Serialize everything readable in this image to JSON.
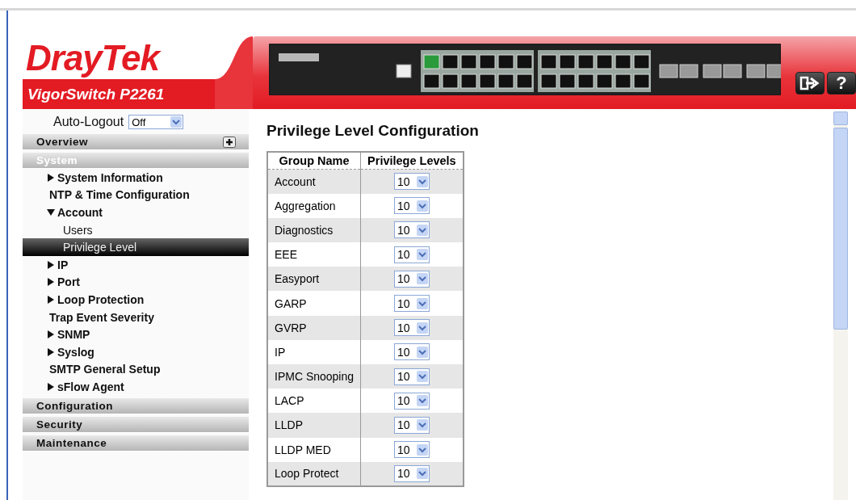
{
  "header": {
    "logo": "DrayTek",
    "model": "VigorSwitch P2261",
    "help_button": "?"
  },
  "auto_logout": {
    "label": "Auto-Logout",
    "value": "Off"
  },
  "sidebar": {
    "sections": [
      {
        "label": "Overview",
        "selected": false
      },
      {
        "label": "System",
        "selected": true,
        "children": [
          {
            "label": "System Information",
            "kind": "folder",
            "expanded": false,
            "selected": false
          },
          {
            "label": "NTP & Time Configuration",
            "kind": "leaf",
            "selected": false
          },
          {
            "label": "Account",
            "kind": "folder",
            "expanded": true,
            "selected": false,
            "children": [
              {
                "label": "Users",
                "kind": "leaf",
                "selected": false
              },
              {
                "label": "Privilege Level",
                "kind": "leaf",
                "selected": true
              }
            ]
          },
          {
            "label": "IP",
            "kind": "folder",
            "expanded": false,
            "selected": false
          },
          {
            "label": "Port",
            "kind": "folder",
            "expanded": false,
            "selected": false
          },
          {
            "label": "Loop Protection",
            "kind": "folder",
            "expanded": false,
            "selected": false
          },
          {
            "label": "Trap Event Severity",
            "kind": "leaf",
            "selected": false
          },
          {
            "label": "SNMP",
            "kind": "folder",
            "expanded": false,
            "selected": false
          },
          {
            "label": "Syslog",
            "kind": "folder",
            "expanded": false,
            "selected": false
          },
          {
            "label": "SMTP General Setup",
            "kind": "leaf",
            "selected": false
          },
          {
            "label": "sFlow Agent",
            "kind": "folder",
            "expanded": false,
            "selected": false
          }
        ]
      },
      {
        "label": "Configuration",
        "selected": false
      },
      {
        "label": "Security",
        "selected": false
      },
      {
        "label": "Maintenance",
        "selected": false
      }
    ]
  },
  "content": {
    "title": "Privilege Level Configuration",
    "table": {
      "columns": [
        "Group Name",
        "Privilege Levels"
      ],
      "rows": [
        {
          "group": "Account",
          "level": "10"
        },
        {
          "group": "Aggregation",
          "level": "10"
        },
        {
          "group": "Diagnostics",
          "level": "10"
        },
        {
          "group": "EEE",
          "level": "10"
        },
        {
          "group": "Easyport",
          "level": "10"
        },
        {
          "group": "GARP",
          "level": "10"
        },
        {
          "group": "GVRP",
          "level": "10"
        },
        {
          "group": "IP",
          "level": "10"
        },
        {
          "group": "IPMC Snooping",
          "level": "10"
        },
        {
          "group": "LACP",
          "level": "10"
        },
        {
          "group": "LLDP",
          "level": "10"
        },
        {
          "group": "LLDP MED",
          "level": "10"
        },
        {
          "group": "Loop Protect",
          "level": "10"
        }
      ]
    }
  }
}
